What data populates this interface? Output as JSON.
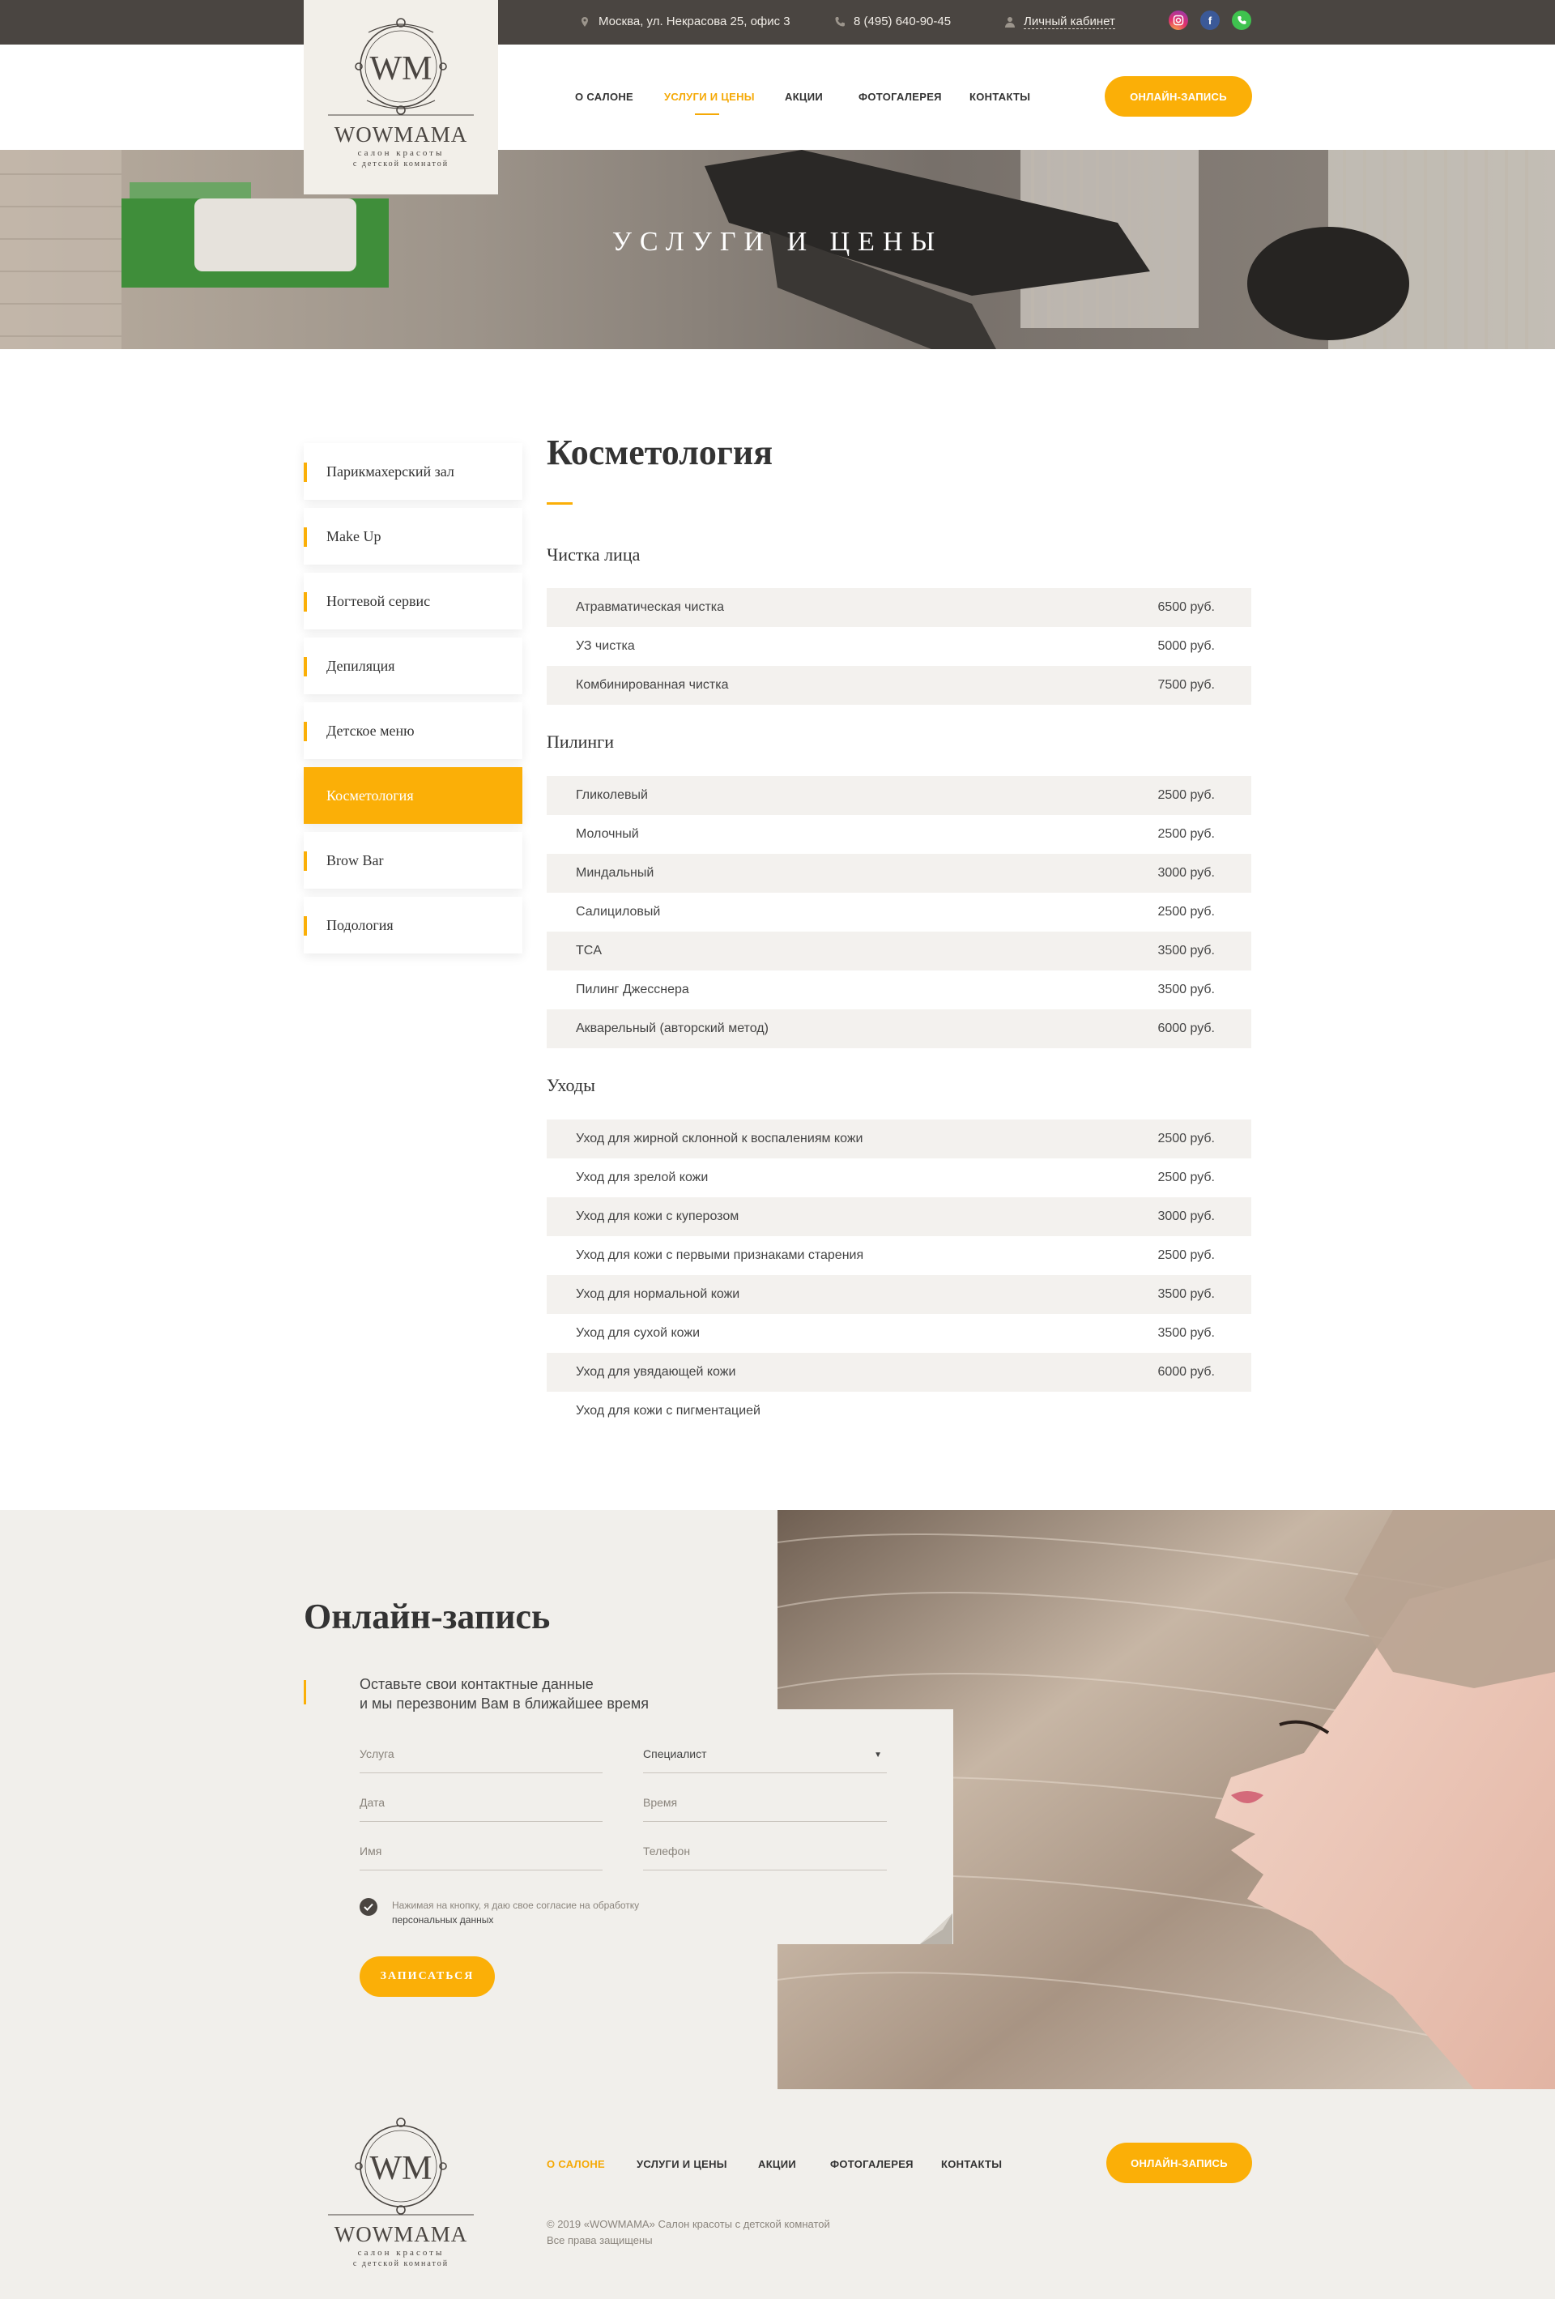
{
  "topbar": {
    "address": "Москва, ул. Некрасова 25, офис 3",
    "phone": "8 (495) 640-90-45",
    "cabinet": "Личный кабинет",
    "social": [
      "instagram-icon",
      "facebook-icon",
      "whatsapp-icon"
    ]
  },
  "logo": {
    "mark": "WM",
    "name": "WOWMAMA",
    "tagline1": "салон красоты",
    "tagline2": "с детской комнатой"
  },
  "nav": {
    "items": [
      "О САЛОНЕ",
      "УСЛУГИ И ЦЕНЫ",
      "АКЦИИ",
      "ФОТОГАЛЕРЕЯ",
      "КОНТАКТЫ"
    ],
    "active": "УСЛУГИ И ЦЕНЫ",
    "cta": "ОНЛАЙН-ЗАПИСЬ"
  },
  "hero": {
    "title": "УСЛУГИ И ЦЕНЫ"
  },
  "sidebar": {
    "items": [
      "Парикмахерский зал",
      "Make Up",
      "Ногтевой сервис",
      "Депиляция",
      "Детское меню",
      "Косметология",
      "Brow Bar",
      "Подология"
    ],
    "active": "Косметология"
  },
  "content": {
    "title": "Косметология",
    "sections": [
      {
        "title": "Чистка лица",
        "rows": [
          {
            "name": "Атравматическая чистка",
            "price": "6500 руб."
          },
          {
            "name": "УЗ чистка",
            "price": "5000 руб."
          },
          {
            "name": "Комбинированная чистка",
            "price": "7500 руб."
          }
        ]
      },
      {
        "title": "Пилинги",
        "rows": [
          {
            "name": "Гликолевый",
            "price": "2500 руб."
          },
          {
            "name": "Молочный",
            "price": "2500 руб."
          },
          {
            "name": "Миндальный",
            "price": "3000 руб."
          },
          {
            "name": "Салициловый",
            "price": "2500 руб."
          },
          {
            "name": "TCA",
            "price": "3500 руб."
          },
          {
            "name": "Пилинг Джесснера",
            "price": "3500 руб."
          },
          {
            "name": "Акварельный (авторский метод)",
            "price": "6000 руб."
          }
        ]
      },
      {
        "title": "Уходы",
        "rows": [
          {
            "name": "Уход для жирной склонной к воспалениям кожи",
            "price": "2500 руб."
          },
          {
            "name": "Уход для зрелой кожи",
            "price": "2500 руб."
          },
          {
            "name": "Уход для кожи с куперозом",
            "price": "3000 руб."
          },
          {
            "name": "Уход для кожи с первыми признаками старения",
            "price": "2500 руб."
          },
          {
            "name": "Уход для нормальной кожи",
            "price": "3500 руб."
          },
          {
            "name": "Уход для сухой кожи",
            "price": "3500 руб."
          },
          {
            "name": "Уход для увядающей кожи",
            "price": "6000 руб."
          },
          {
            "name": "Уход для кожи с пигментацией",
            "price": ""
          }
        ]
      }
    ]
  },
  "booking": {
    "title": "Онлайн-запись",
    "subtitle1": "Оставьте свои контактные данные",
    "subtitle2": "и мы перезвоним Вам в ближайшее время",
    "fields": {
      "service": "Услуга",
      "specialist": "Специалист",
      "date": "Дата",
      "time": "Время",
      "name": "Имя",
      "phone": "Телефон"
    },
    "consent1": "Нажимая на кнопку, я даю свое согласие на обработку",
    "consent2": "персональных данных",
    "submit": "ЗАПИСАТЬСЯ"
  },
  "footer": {
    "nav": [
      "О САЛОНЕ",
      "УСЛУГИ И ЦЕНЫ",
      "АКЦИИ",
      "ФОТОГАЛЕРЕЯ",
      "КОНТАКТЫ"
    ],
    "active": "О САЛОНЕ",
    "cta": "ОНЛАЙН-ЗАПИСЬ",
    "copyright": "© 2019 «WOWMAMA» Салон красоты с детской комнатой",
    "rights": "Все права защищены"
  },
  "colors": {
    "accent": "#fbaf07",
    "topbar": "#4a4541",
    "stripe": "#f3f1ee",
    "footer_bg": "#f1efeb"
  }
}
